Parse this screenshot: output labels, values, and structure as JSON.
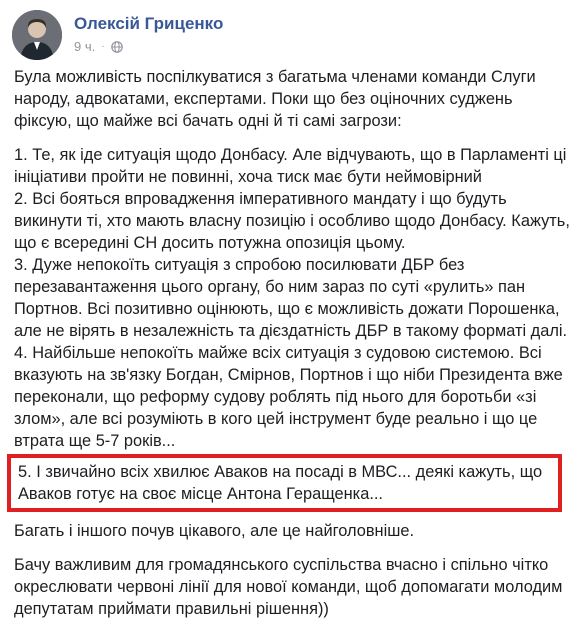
{
  "post": {
    "author": "Олексій Гриценко",
    "time": "9 ч.",
    "separator": "·",
    "privacy_icon": "globe-icon",
    "intro": "Була можливість поспілкуватися з багатьма членами команди Слуги народу, адвокатами, експертами. Поки що без оціночних суджень фіксую, що майже всі бачать одні й ті самі загрози:",
    "points": [
      "1. Те, як іде ситуація щодо Донбасу. Але відчувають, що в Парламенті ці ініціативи пройти не повинні, хоча тиск має бути неймовірний",
      "2. Всі бояться впровадження імперативного мандату і що будуть викинути ті, хто мають власну позицію і особливо щодо Донбасу. Кажуть, що є всередині СН досить потужна опозиція цьому.",
      "3. Дуже непокоїть ситуація з спробою посилювати ДБР без перезавантаження цього органу, бо ним зараз по суті «рулить» пан Портнов. Всі позитивно оцінюють, що є можливість дожати Порошенка, але не вірять в незалежність та дієздатність ДБР в такому форматі далі.",
      "4. Найбільше непокоїть майже всіх ситуація з судовою системою. Всі вказують на зв'язку Богдан, Смірнов, Портнов і що ніби Президента вже переконали, що реформу судову роблять під нього для боротьби «зі злом», але всі розуміють в кого цей інструмент буде реально і що це втрата ще 5-7 років..."
    ],
    "highlighted_point": "5. І звичайно всіх хвилює Аваков на посаді в МВС... деякі кажуть, що Аваков готує на своє місце Антона Геращенка...",
    "after_highlight": "Багать і іншого почув цікавого, але це найголовніше.",
    "conclusion": "Бачу важливим для громадянського суспільства вчасно і спільно чітко окреслювати червоні лінії для нової команди, щоб допомагати молодим депутатам приймати правильні рішення))",
    "highlight_color": "#e02020",
    "name_color": "#385898"
  }
}
